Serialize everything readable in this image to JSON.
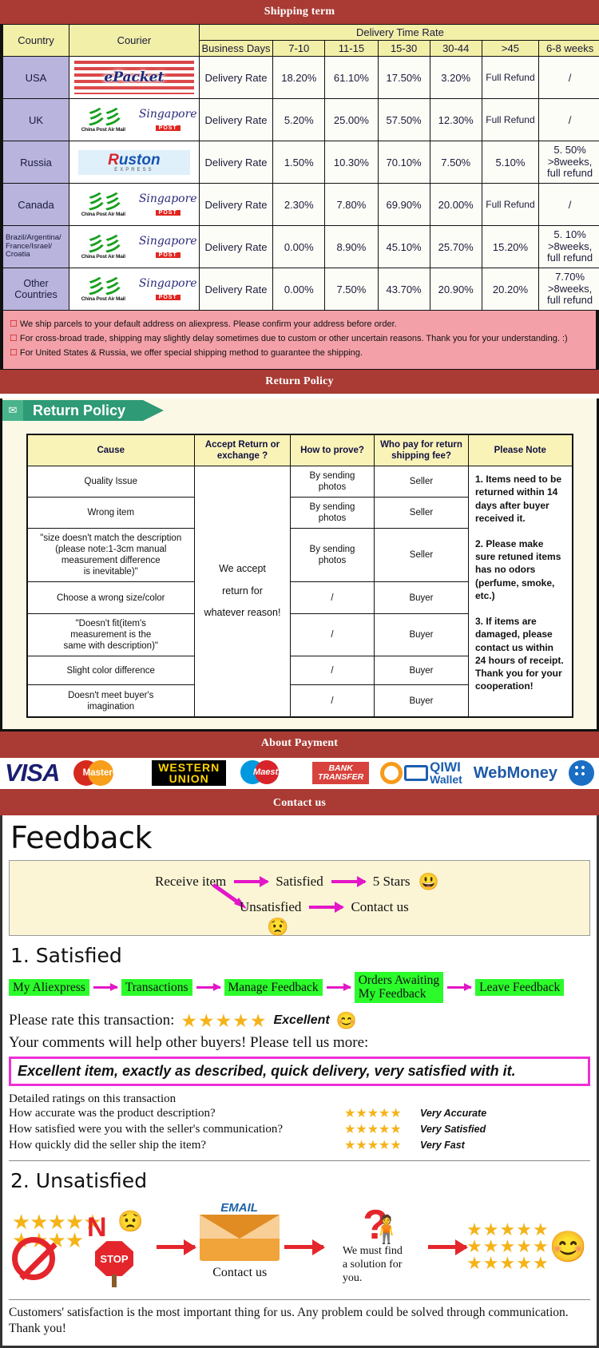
{
  "sections": {
    "shipping_title": "Shipping term",
    "return_title": "Return Policy",
    "payment_title": "About Payment",
    "contact_title": "Contact us"
  },
  "shipping": {
    "headers": {
      "country": "Country",
      "courier": "Courier",
      "delivery_time_rate": "Delivery Time Rate",
      "business_days": "Business Days",
      "d1": "7-10",
      "d2": "11-15",
      "d3": "15-30",
      "d4": "30-44",
      "d5": ">45",
      "d6": "6-8 weeks"
    },
    "rate_label": "Delivery Rate",
    "rows": [
      {
        "country": "USA",
        "couriers": [
          "ePacket"
        ],
        "values": [
          "18.20%",
          "61.10%",
          "17.50%",
          "3.20%",
          "Full Refund",
          "/"
        ]
      },
      {
        "country": "UK",
        "couriers": [
          "China Post Air Mail",
          "Singapore POST"
        ],
        "values": [
          "5.20%",
          "25.00%",
          "57.50%",
          "12.30%",
          "Full Refund",
          "/"
        ]
      },
      {
        "country": "Russia",
        "couriers": [
          "Ruston EXPRESS"
        ],
        "values": [
          "1.50%",
          "10.30%",
          "70.10%",
          "7.50%",
          "5.10%",
          "5. 50%\n>8weeks,\nfull refund"
        ]
      },
      {
        "country": "Canada",
        "couriers": [
          "China Post Air Mail",
          "Singapore POST"
        ],
        "values": [
          "2.30%",
          "7.80%",
          "69.90%",
          "20.00%",
          "Full Refund",
          "/"
        ]
      },
      {
        "country": "Brazil/Argentina/France/Israel/Croatia",
        "couriers": [
          "China Post Air Mail",
          "Singapore POST"
        ],
        "values": [
          "0.00%",
          "8.90%",
          "45.10%",
          "25.70%",
          "15.20%",
          "5. 10%\n>8weeks,\nfull refund"
        ]
      },
      {
        "country": "Other Countries",
        "couriers": [
          "China Post Air Mail",
          "Singapore POST"
        ],
        "values": [
          "0.00%",
          "7.50%",
          "43.70%",
          "20.90%",
          "20.20%",
          "7.70%\n>8weeks,\nfull refund"
        ]
      }
    ],
    "notes": [
      "We ship parcels to your default address on aliexpress. Please confirm your address before order.",
      "For cross-broad trade, shipping may slightly delay sometimes due to custom or other uncertain reasons. Thank you for your understanding. :)",
      "For United States & Russia, we offer special shipping method to guarantee the shipping."
    ]
  },
  "return_policy": {
    "tab_label": "Return Policy",
    "headers": [
      "Cause",
      "Accept Return or exchange ?",
      "How to prove?",
      "Who pay for return shipping fee?",
      "Please Note"
    ],
    "accept_text": "We accept\nreturn for\nwhatever reason!",
    "rows": [
      {
        "cause": "Quality Issue",
        "prove": "By sending\nphotos",
        "payer": "Seller"
      },
      {
        "cause": "Wrong item",
        "prove": "By sending\nphotos",
        "payer": "Seller"
      },
      {
        "cause": "\"size doesn't match the description\n(please note:1-3cm manual\nmeasurement difference\nis inevitable)\"",
        "prove": "By sending\nphotos",
        "payer": "Seller"
      },
      {
        "cause": "Choose a wrong size/color",
        "prove": "/",
        "payer": "Buyer"
      },
      {
        "cause": "\"Doesn't fit(item's\nmeasurement is the\nsame with description)\"",
        "prove": "/",
        "payer": "Buyer"
      },
      {
        "cause": "Slight color difference",
        "prove": "/",
        "payer": "Buyer"
      },
      {
        "cause": "Doesn't meet buyer's\nimagination",
        "prove": "/",
        "payer": "Buyer"
      }
    ],
    "note": "1. Items need to be returned within 14 days after buyer received it.\n\n2. Please make sure retuned items has no odors (perfume, smoke, etc.)\n\n3. If items are damaged, please contact us within 24 hours of receipt.\nThank you for your cooperation!"
  },
  "payment": {
    "methods": [
      {
        "name": "VISA",
        "label": "VISA"
      },
      {
        "name": "MasterCard",
        "label": "MasterCard"
      },
      {
        "name": "Western Union",
        "line1": "WESTERN",
        "line2": "UNION"
      },
      {
        "name": "Maestro",
        "label": "Maestro"
      },
      {
        "name": "Bank Transfer",
        "line1": "BANK",
        "line2": "TRANSFER"
      },
      {
        "name": "QIWI Wallet",
        "line1": "QIWI",
        "line2": "Wallet"
      },
      {
        "name": "WebMoney",
        "label": "WebMoney"
      }
    ]
  },
  "feedback": {
    "title": "Feedback",
    "flow": {
      "receive": "Receive item",
      "satisfied": "Satisfied",
      "five_stars": "5 Stars",
      "unsatisfied": "Unsatisfied",
      "contact_us": "Contact us",
      "happy_face": "🙂",
      "sad_face": "☹"
    },
    "satisfied_heading": "1. Satisfied",
    "steps": [
      "My Aliexpress",
      "Transactions",
      "Manage Feedback",
      "Orders Awaiting\nMy Feedback",
      "Leave Feedback"
    ],
    "rate_prompt": "Please rate this transaction:",
    "rate_stars": "★★★★★",
    "rate_word": "Excellent",
    "comments_prompt": "Your comments will help other buyers! Please tell us more:",
    "comment_text": "Excellent item, exactly as described, quick delivery, very satisfied with it.",
    "detailed_heading": "Detailed ratings on this transaction",
    "detailed": [
      {
        "question": "How accurate was the product description?",
        "stars": "★★★★★",
        "value": "Very Accurate"
      },
      {
        "question": "How satisfied were you with the seller's communication?",
        "stars": "★★★★★",
        "value": "Very Satisfied"
      },
      {
        "question": "How quickly did the seller ship the item?",
        "stars": "★★★★★",
        "value": "Very Fast"
      }
    ],
    "unsatisfied_heading": "2. Unsatisfied",
    "unsat": {
      "no_letter": "N",
      "stop_label": "STOP",
      "email_label": "EMAIL",
      "contact_caption": "Contact us",
      "solution_caption": "We must find\na solution for\nyou.",
      "stars_block": "★★★★★\n★★★★★\n★★★★★"
    },
    "closing": "Customers' satisfaction is the most important thing for us. Any problem could be solved through communication. Thank you!"
  },
  "colors": {
    "banner_red": "#a93b34",
    "header_yellow": "#f2efa8",
    "country_purple": "#b8b4dd",
    "note_pink": "#f3a0a8",
    "step_green": "#2bfb2b",
    "magenta": "#e316c8",
    "star_gold": "#f5b31a"
  }
}
